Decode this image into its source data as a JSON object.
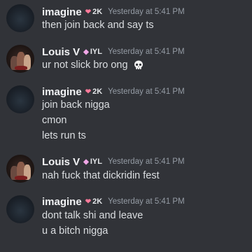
{
  "messages": [
    {
      "user": "imagine",
      "tag_icon": "heart-icon",
      "tag": "2K",
      "time": "Yesterday at 5:41 PM",
      "lines": [
        "then join back and say ts"
      ]
    },
    {
      "user": "Louis V",
      "tag_icon": "gem-icon",
      "tag": "IYL",
      "time": "Yesterday at 5:41 PM",
      "lines": [
        "ur not slick bro ong"
      ]
    },
    {
      "user": "imagine",
      "tag_icon": "heart-icon",
      "tag": "2K",
      "time": "Yesterday at 5:41 PM",
      "lines": [
        "join back nigga",
        "cmon",
        "lets run ts"
      ]
    },
    {
      "user": "Louis V",
      "tag_icon": "gem-icon",
      "tag": "IYL",
      "time": "Yesterday at 5:41 PM",
      "lines": [
        "nah fuck that dickridin fest"
      ]
    },
    {
      "user": "imagine",
      "tag_icon": "heart-icon",
      "tag": "2K",
      "time": "Yesterday at 5:41 PM",
      "lines": [
        "dont talk shi and leave",
        "u a bitch nigga"
      ]
    }
  ],
  "emoji": {
    "skull": "skull-emoji-icon"
  },
  "colors": {
    "background": "#313338",
    "username": "#f2f3f5",
    "message_text": "#dbdee1",
    "timestamp": "#949ba4"
  }
}
